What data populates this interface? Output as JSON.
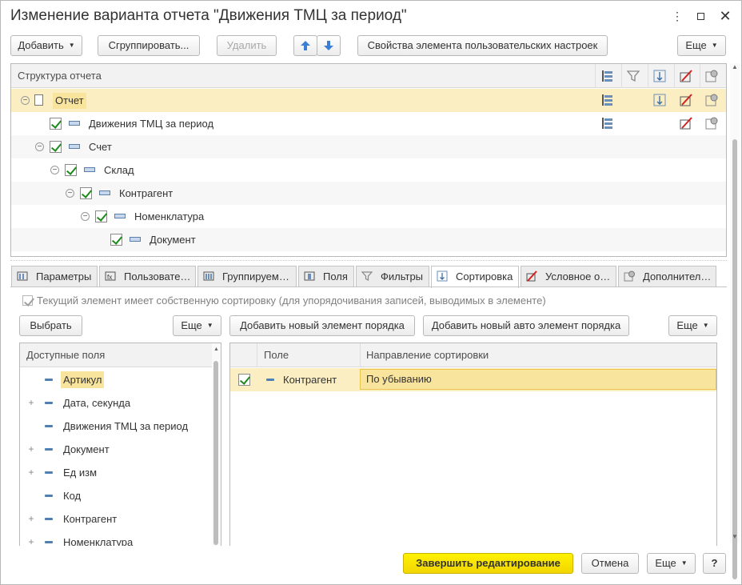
{
  "window": {
    "title": "Изменение варианта отчета \"Движения ТМЦ за период\"",
    "controls": [
      "more-vertical-icon",
      "maximize-icon",
      "close-icon"
    ]
  },
  "toolbar": {
    "add": "Добавить",
    "group": "Сгруппировать...",
    "delete": "Удалить",
    "properties": "Свойства элемента пользовательских настроек",
    "more": "Еще"
  },
  "structure": {
    "header": "Структура отчета",
    "rows": [
      {
        "label": "Отчет"
      },
      {
        "label": "Движения ТМЦ за период"
      },
      {
        "label": "Счет"
      },
      {
        "label": "Склад"
      },
      {
        "label": "Контрагент"
      },
      {
        "label": "Номенклатура"
      },
      {
        "label": "Документ"
      }
    ]
  },
  "tabs": [
    {
      "label": "Параметры",
      "icon": "parameters-icon"
    },
    {
      "label": "Пользовате…",
      "icon": "user-fields-icon"
    },
    {
      "label": "Группируем…",
      "icon": "grouping-icon"
    },
    {
      "label": "Поля",
      "icon": "fields-icon"
    },
    {
      "label": "Фильтры",
      "icon": "filter-icon"
    },
    {
      "label": "Сортировка",
      "icon": "sort-icon",
      "active": true
    },
    {
      "label": "Условное о…",
      "icon": "conditional-format-icon"
    },
    {
      "label": "Дополнител…",
      "icon": "additional-icon"
    }
  ],
  "sorting": {
    "own_sort_label": "Текущий элемент имеет собственную сортировку (для  упорядочивания записей, выводимых в элементе)",
    "select": "Выбрать",
    "more_left": "Еще",
    "add_order": "Добавить новый элемент порядка",
    "add_auto_order": "Добавить новый авто элемент порядка",
    "more_right": "Еще",
    "available_header": "Доступные поля",
    "available": [
      {
        "label": "Артикул",
        "expandable": false
      },
      {
        "label": "Дата, секунда",
        "expandable": true
      },
      {
        "label": "Движения ТМЦ за период",
        "expandable": false
      },
      {
        "label": "Документ",
        "expandable": true
      },
      {
        "label": "Ед изм",
        "expandable": true
      },
      {
        "label": "Код",
        "expandable": false
      },
      {
        "label": "Контрагент",
        "expandable": true
      },
      {
        "label": "Номенклатура",
        "expandable": true
      }
    ],
    "col_field": "Поле",
    "col_direction": "Направление сортировки",
    "order_rows": [
      {
        "field": "Контрагент",
        "direction": "По убыванию"
      }
    ]
  },
  "footer": {
    "finish": "Завершить редактирование",
    "cancel": "Отмена",
    "more": "Еще",
    "help": "?"
  },
  "colors": {
    "accent_yellow": "#f5e000",
    "selection": "#fbeec2",
    "check": "#1e8a1e"
  }
}
